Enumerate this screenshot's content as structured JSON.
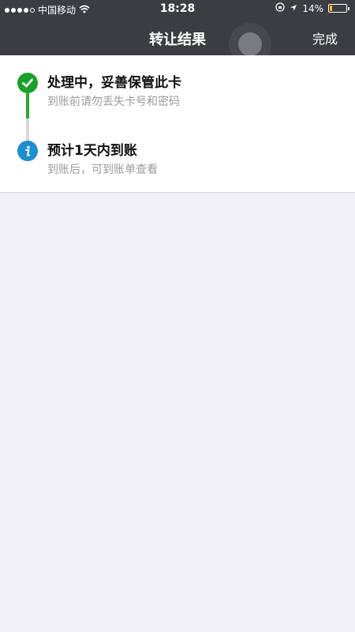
{
  "status_bar": {
    "carrier": "中国移动",
    "time": "18:28",
    "battery_percent": "14%",
    "battery_level": 0.14
  },
  "nav": {
    "title": "转让结果",
    "done_label": "完成"
  },
  "steps": [
    {
      "title": "处理中，妥善保管此卡",
      "subtitle": "到账前请勿丢失卡号和密码",
      "status": "done",
      "icon": "check-icon",
      "color": "#1aa12b"
    },
    {
      "title": "预计1天内到账",
      "subtitle": "到账后，可到账单查看",
      "status": "info",
      "icon": "info-icon",
      "color": "#1c8fd1"
    }
  ]
}
